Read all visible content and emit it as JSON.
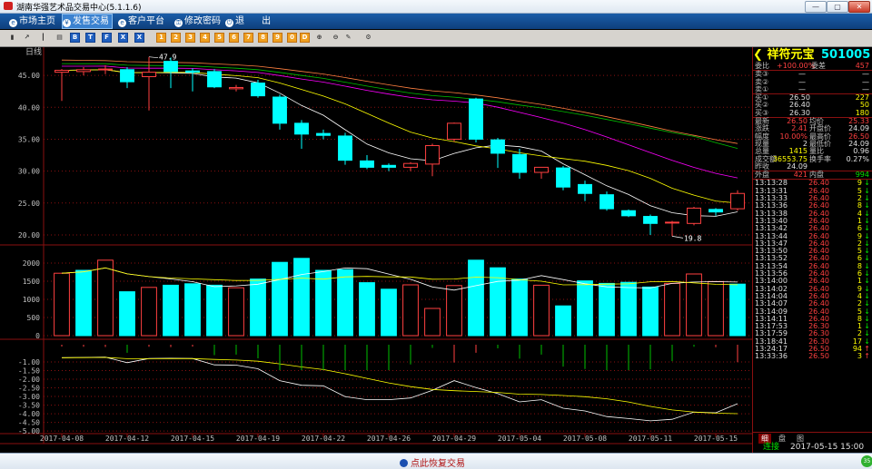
{
  "window": {
    "title": "湖南华强艺术品交易中心(5.1.1.6)",
    "btn_min": "—",
    "btn_max": "▢",
    "btn_close": "✕"
  },
  "menu": [
    {
      "label": "市场主页",
      "icon": "e-icon",
      "glyph": "e"
    },
    {
      "label": "发售交易",
      "icon": "yen-icon",
      "glyph": "¥",
      "active": true
    },
    {
      "label": "客户平台",
      "icon": "e-icon",
      "glyph": "e"
    },
    {
      "label": "修改密码",
      "icon": "key-icon",
      "glyph": "⚿"
    },
    {
      "label": "退 出",
      "icon": "power-icon",
      "glyph": "⏻"
    }
  ],
  "toolbar_icons": [
    {
      "name": "bar-chart-icon",
      "cls": "g",
      "glyph": "▮"
    },
    {
      "name": "line-chart-icon",
      "cls": "g",
      "glyph": "↗"
    },
    {
      "name": "kline-icon",
      "cls": "g",
      "glyph": "┃"
    },
    {
      "name": "table-icon",
      "cls": "g",
      "glyph": "▤"
    },
    {
      "name": "b-icon",
      "cls": "b",
      "glyph": "B"
    },
    {
      "name": "t-icon",
      "cls": "b",
      "glyph": "T"
    },
    {
      "name": "f-icon",
      "cls": "b",
      "glyph": "F"
    },
    {
      "name": "x-icon",
      "cls": "b",
      "glyph": "X"
    },
    {
      "name": "x2-icon",
      "cls": "b",
      "glyph": "X"
    },
    {
      "name": "tool-1-icon",
      "cls": "o",
      "glyph": "1"
    },
    {
      "name": "tool-2-icon",
      "cls": "o",
      "glyph": "2"
    },
    {
      "name": "tool-3-icon",
      "cls": "o",
      "glyph": "3"
    },
    {
      "name": "tool-4-icon",
      "cls": "o",
      "glyph": "4"
    },
    {
      "name": "tool-5-icon",
      "cls": "o",
      "glyph": "5"
    },
    {
      "name": "tool-6-icon",
      "cls": "o",
      "glyph": "6"
    },
    {
      "name": "tool-7-icon",
      "cls": "o",
      "glyph": "7"
    },
    {
      "name": "tool-8-icon",
      "cls": "o",
      "glyph": "8"
    },
    {
      "name": "tool-9-icon",
      "cls": "o",
      "glyph": "9"
    },
    {
      "name": "tool-10-icon",
      "cls": "o",
      "glyph": "0"
    },
    {
      "name": "tool-11-icon",
      "cls": "o",
      "glyph": "D"
    },
    {
      "name": "zoom-in-icon",
      "cls": "g",
      "glyph": "⊕"
    },
    {
      "name": "zoom-out-icon",
      "cls": "g",
      "glyph": "⊖"
    },
    {
      "name": "draw-icon",
      "cls": "g",
      "glyph": "✎"
    },
    {
      "name": "settings-icon",
      "cls": "g",
      "glyph": "⚙"
    }
  ],
  "colors": {
    "up": "#ff4040",
    "down": "#00ffff",
    "ma5": "#ffffff",
    "ma10": "#ffff00",
    "ma20": "#ff00ff",
    "ma30": "#00c000",
    "ma60": "#ff8040",
    "grid": "#8a1010"
  },
  "chart_data": {
    "type": "candlestick",
    "period_label": "日线",
    "dates": [
      "2017-04-08",
      "2017-04-10",
      "2017-04-11",
      "2017-04-12",
      "2017-04-13",
      "2017-04-14",
      "2017-04-15",
      "2017-04-17",
      "2017-04-18",
      "2017-04-19",
      "2017-04-20",
      "2017-04-21",
      "2017-04-22",
      "2017-04-24",
      "2017-04-25",
      "2017-04-26",
      "2017-04-27",
      "2017-04-28",
      "2017-04-29",
      "2017-05-02",
      "2017-05-03",
      "2017-05-04",
      "2017-05-05",
      "2017-05-06",
      "2017-05-08",
      "2017-05-09",
      "2017-05-10",
      "2017-05-11",
      "2017-05-12",
      "2017-05-13",
      "2017-05-15",
      "2017-05-16"
    ],
    "date_labels": [
      "2017-04-08",
      "2017-04-12",
      "2017-04-15",
      "2017-04-19",
      "2017-04-22",
      "2017-04-26",
      "2017-04-29",
      "2017-05-04",
      "2017-05-08",
      "2017-05-11",
      "2017-05-15"
    ],
    "date_label_index": [
      0,
      3,
      6,
      9,
      12,
      15,
      18,
      21,
      24,
      27,
      30
    ],
    "ohlc": [
      [
        45.5,
        46.0,
        41.0,
        45.8
      ],
      [
        45.6,
        46.3,
        45.0,
        45.9
      ],
      [
        46.0,
        46.6,
        45.2,
        46.0
      ],
      [
        45.9,
        46.3,
        43.0,
        44.0
      ],
      [
        44.8,
        47.9,
        39.5,
        45.5
      ],
      [
        47.2,
        47.8,
        43.0,
        45.6
      ],
      [
        45.7,
        46.1,
        42.5,
        45.5
      ],
      [
        45.6,
        46.0,
        43.0,
        43.2
      ],
      [
        42.9,
        43.5,
        42.5,
        43.1
      ],
      [
        43.8,
        44.3,
        41.5,
        41.8
      ],
      [
        41.6,
        42.0,
        36.5,
        37.5
      ],
      [
        37.5,
        38.0,
        33.5,
        35.8
      ],
      [
        35.9,
        36.5,
        35.0,
        35.6
      ],
      [
        35.5,
        36.0,
        31.0,
        31.7
      ],
      [
        31.6,
        32.5,
        30.3,
        30.6
      ],
      [
        30.9,
        31.2,
        30.0,
        30.6
      ],
      [
        30.6,
        31.4,
        30.0,
        31.2
      ],
      [
        31.1,
        34.3,
        29.2,
        34.0
      ],
      [
        35.0,
        37.6,
        34.6,
        37.5
      ],
      [
        41.3,
        41.5,
        34.5,
        35.0
      ],
      [
        34.9,
        35.2,
        30.5,
        32.8
      ],
      [
        32.6,
        33.5,
        28.8,
        29.8
      ],
      [
        29.8,
        30.5,
        28.8,
        30.6
      ],
      [
        30.5,
        30.8,
        27.0,
        27.5
      ],
      [
        27.9,
        28.5,
        25.3,
        26.5
      ],
      [
        26.3,
        26.8,
        23.8,
        24.1
      ],
      [
        23.8,
        24.0,
        22.8,
        23.0
      ],
      [
        22.9,
        23.2,
        20.0,
        21.8
      ],
      [
        21.9,
        22.2,
        19.8,
        22.0
      ],
      [
        21.8,
        24.4,
        21.5,
        24.2
      ],
      [
        24.0,
        24.2,
        23.0,
        23.6
      ],
      [
        24.1,
        27.0,
        23.8,
        26.5
      ]
    ],
    "volume": [
      1720,
      1800,
      2080,
      1210,
      1330,
      1390,
      1430,
      1390,
      1320,
      1560,
      2020,
      2130,
      1800,
      1820,
      1460,
      1280,
      1400,
      750,
      1380,
      2080,
      1870,
      1560,
      1390,
      820,
      1510,
      1440,
      1470,
      1340,
      1440,
      1700,
      1490,
      1420
    ],
    "volume_up": [
      true,
      false,
      true,
      false,
      true,
      false,
      false,
      false,
      true,
      false,
      false,
      false,
      false,
      false,
      false,
      false,
      true,
      true,
      true,
      false,
      false,
      false,
      true,
      false,
      false,
      false,
      false,
      false,
      true,
      true,
      true,
      false
    ],
    "price_axis": {
      "ticks": [
        "45.00",
        "40.00",
        "35.00",
        "30.00",
        "25.00",
        "20.00"
      ],
      "min": 19,
      "max": 48
    },
    "volume_axis": {
      "ticks": [
        "2000",
        "1500",
        "1000",
        "500",
        "0"
      ],
      "max": 2400
    },
    "macd_axis": {
      "ticks": [
        "-1.00",
        "-1.50",
        "-2.00",
        "-2.50",
        "-3.00",
        "-3.50",
        "-4.00",
        "-4.50",
        "-5.00"
      ],
      "min": -5.1,
      "max": 0
    },
    "high_mark": "47.9",
    "low_mark": "19.8"
  },
  "quote": {
    "name": "祥符元宝",
    "code": "501005",
    "rows1": [
      {
        "l": "委比",
        "v": "+100.00%",
        "l2": "委差",
        "v2": "457",
        "cls": "red",
        "cls2": "red"
      }
    ],
    "sells": [
      {
        "l": "卖③",
        "p": "—",
        "q": "—"
      },
      {
        "l": "卖②",
        "p": "—",
        "q": "—"
      },
      {
        "l": "卖①",
        "p": "—",
        "q": "—"
      }
    ],
    "buys": [
      {
        "l": "买①",
        "p": "26.50",
        "q": "227"
      },
      {
        "l": "买②",
        "p": "26.40",
        "q": "50"
      },
      {
        "l": "买③",
        "p": "26.30",
        "q": "180"
      }
    ],
    "stats": [
      {
        "l": "最新",
        "v": "26.50",
        "l2": "均价",
        "v2": "25.33",
        "cls": "red",
        "cls2": "red"
      },
      {
        "l": "涨跌",
        "v": "2.41",
        "l2": "开盘价",
        "v2": "24.09",
        "cls": "red",
        "cls2": "wht"
      },
      {
        "l": "幅度",
        "v": "10.00%",
        "l2": "最高价",
        "v2": "26.50",
        "cls": "red",
        "cls2": "red"
      },
      {
        "l": "现量",
        "v": "2",
        "l2": "最低价",
        "v2": "24.09",
        "cls": "wht",
        "cls2": "wht"
      },
      {
        "l": "总量",
        "v": "1415",
        "l2": "量比",
        "v2": "0.96",
        "cls": "yel",
        "cls2": "wht"
      },
      {
        "l": "成交额",
        "v": "36553.75",
        "l2": "换手率",
        "v2": "0.27%",
        "cls": "yel",
        "cls2": "wht"
      },
      {
        "l": "昨收",
        "v": "24.09",
        "l2": "",
        "v2": "",
        "cls": "wht",
        "cls2": "wht"
      }
    ],
    "waipan": {
      "l": "外盘",
      "v": "421",
      "l2": "内盘",
      "v2": "994"
    },
    "ticks": [
      [
        "13:13:28",
        "26.40",
        "9",
        "↓"
      ],
      [
        "13:13:31",
        "26.40",
        "5",
        "↓"
      ],
      [
        "13:13:33",
        "26.40",
        "2",
        "↓"
      ],
      [
        "13:13:36",
        "26.40",
        "8",
        "↓"
      ],
      [
        "13:13:38",
        "26.40",
        "4",
        "↓"
      ],
      [
        "13:13:40",
        "26.40",
        "1",
        "↓"
      ],
      [
        "13:13:42",
        "26.40",
        "6",
        "↓"
      ],
      [
        "13:13:44",
        "26.40",
        "9",
        "↓"
      ],
      [
        "13:13:47",
        "26.40",
        "2",
        "↓"
      ],
      [
        "13:13:50",
        "26.40",
        "5",
        "↓"
      ],
      [
        "13:13:52",
        "26.40",
        "6",
        "↓"
      ],
      [
        "13:13:54",
        "26.40",
        "8",
        "↓"
      ],
      [
        "13:13:56",
        "26.40",
        "6",
        "↓"
      ],
      [
        "13:14:00",
        "26.40",
        "1",
        "↓"
      ],
      [
        "13:14:02",
        "26.40",
        "9",
        "↓"
      ],
      [
        "13:14:04",
        "26.40",
        "4",
        "↓"
      ],
      [
        "13:14:07",
        "26.40",
        "2",
        "↓"
      ],
      [
        "13:14:09",
        "26.40",
        "5",
        "↓"
      ],
      [
        "13:14:11",
        "26.40",
        "8",
        "↓"
      ],
      [
        "13:17:53",
        "26.30",
        "1",
        "↓"
      ],
      [
        "13:17:59",
        "26.30",
        "2",
        "↓"
      ],
      [
        "13:18:41",
        "26.30",
        "17",
        "↓"
      ],
      [
        "13:24:17",
        "26.50",
        "94",
        "↑"
      ],
      [
        "13:33:36",
        "26.50",
        "3",
        "↑"
      ]
    ],
    "tabs": [
      "细",
      "盘",
      "图"
    ],
    "status_conn": "连接",
    "status_time": "2017-05-15 15:00"
  },
  "bottom": {
    "label": "点此恢复交易",
    "badge": "35"
  }
}
